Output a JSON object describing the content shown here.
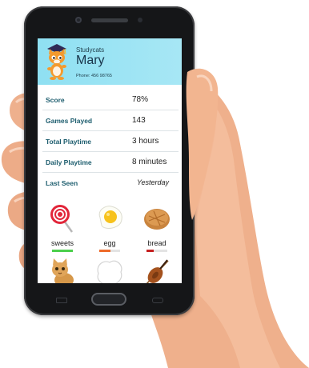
{
  "app": {
    "brand": "Studycats",
    "user_name": "Mary",
    "phone_label": "Phone: 456 98765"
  },
  "stats": [
    {
      "label": "Score",
      "value": "78%"
    },
    {
      "label": "Games Played",
      "value": "143"
    },
    {
      "label": "Total Playtime",
      "value": "3 hours"
    },
    {
      "label": "Daily Playtime",
      "value": "8 minutes"
    },
    {
      "label": "Last Seen",
      "value": "Yesterday"
    }
  ],
  "items": [
    {
      "label": "sweets",
      "icon": "lollipop-icon",
      "progress": 1.0,
      "color": "#4ccf4c"
    },
    {
      "label": "egg",
      "icon": "fried-egg-icon",
      "progress": 0.55,
      "color": "#ee6b2a"
    },
    {
      "label": "bread",
      "icon": "bread-icon",
      "progress": 0.35,
      "color": "#c62020"
    },
    {
      "label": "kitten",
      "icon": "kitten-icon"
    },
    {
      "label": "white",
      "icon": "white-blob-icon"
    },
    {
      "label": "violin",
      "icon": "violin-icon"
    }
  ],
  "colors": {
    "header": "#a0e4f4",
    "label": "#1d5d6e",
    "phone_body": "#151618",
    "skin": "#f1b896"
  }
}
